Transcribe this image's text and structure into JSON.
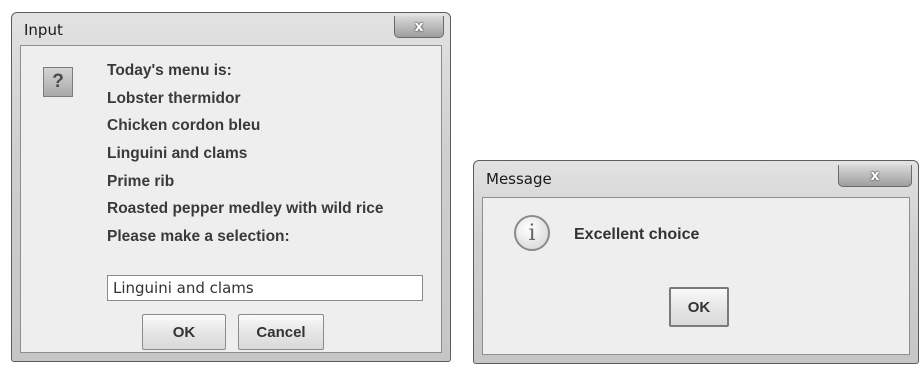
{
  "input_dialog": {
    "title": "Input",
    "close_label": "x",
    "icon": "question-icon",
    "lines": [
      "Today's menu is:",
      "Lobster thermidor",
      "Chicken cordon bleu",
      "Linguini and clams",
      "Prime rib",
      "Roasted pepper medley with wild rice",
      "Please make a selection:"
    ],
    "input_value": "Linguini and clams",
    "ok_label": "OK",
    "cancel_label": "Cancel"
  },
  "message_dialog": {
    "title": "Message",
    "close_label": "x",
    "icon": "info-icon",
    "text": "Excellent choice",
    "ok_label": "OK"
  }
}
